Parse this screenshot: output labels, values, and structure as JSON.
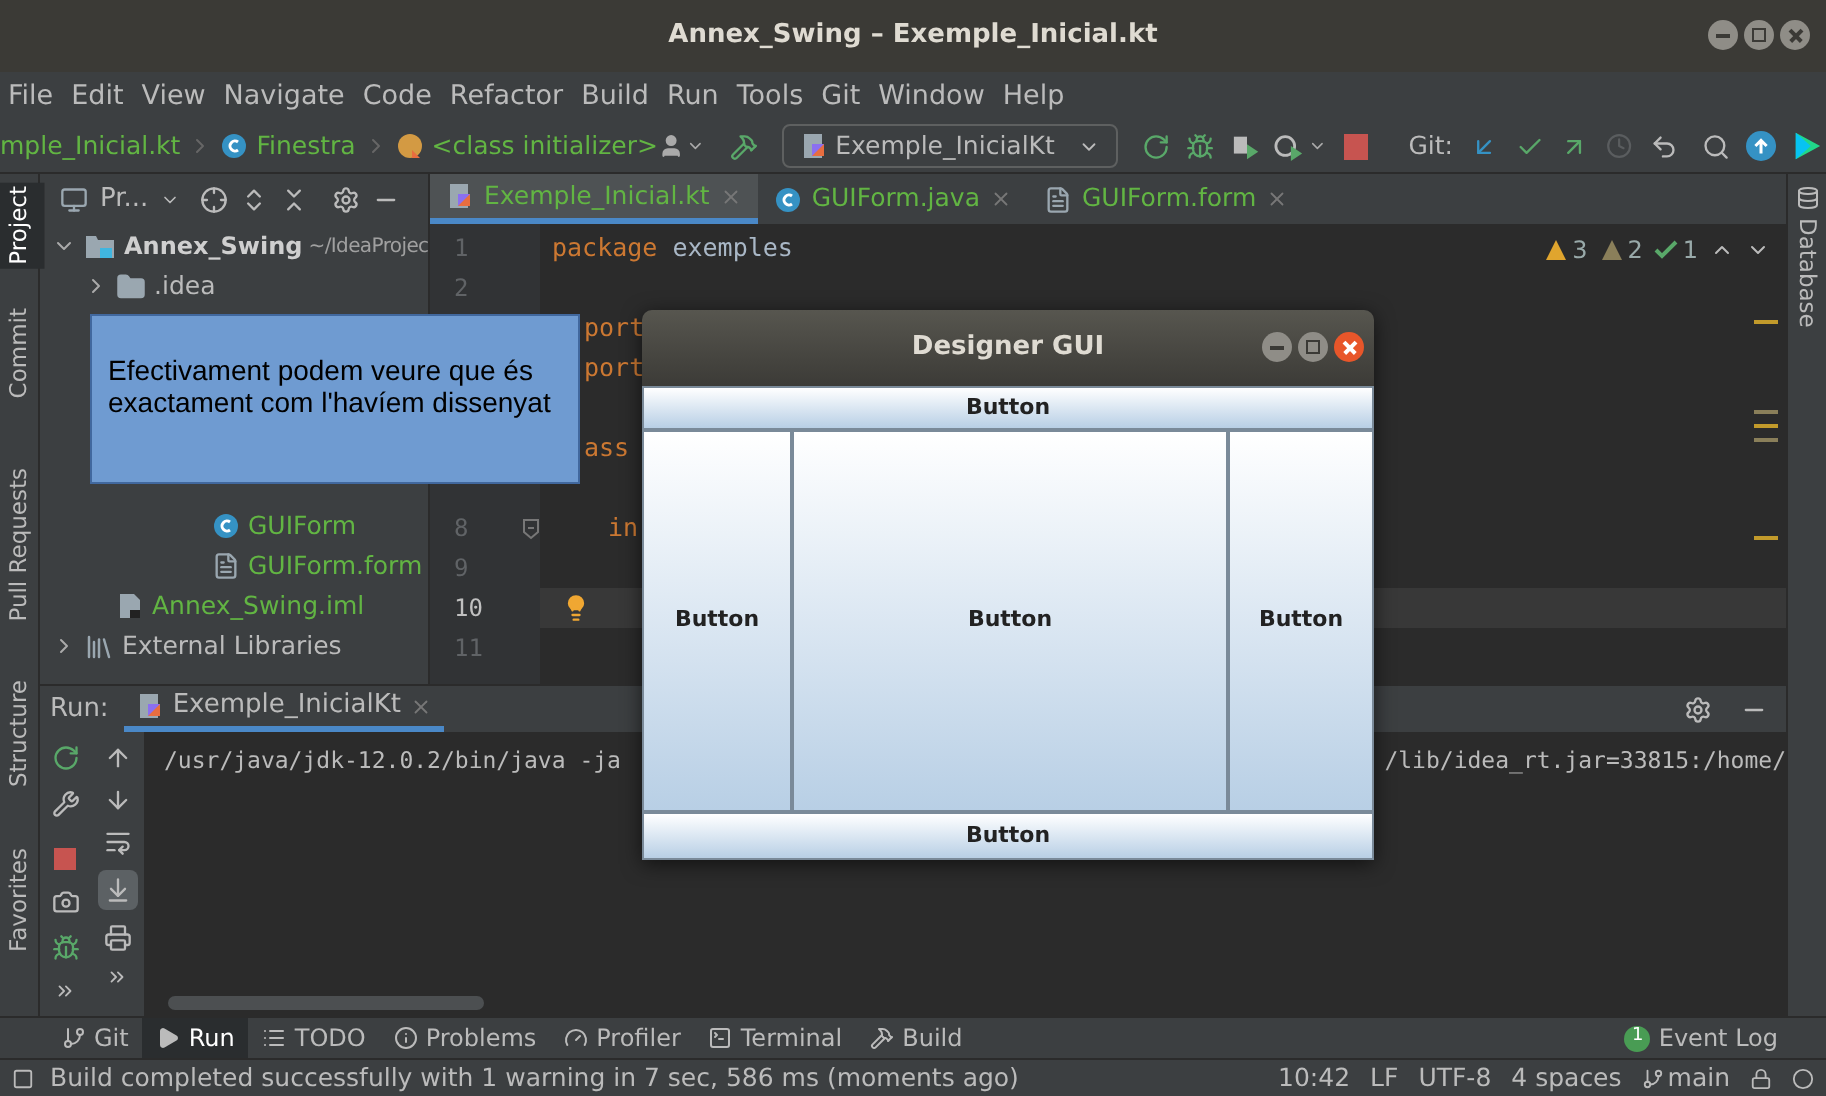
{
  "window": {
    "title": "Annex_Swing – Exemple_Inicial.kt"
  },
  "menu": [
    "File",
    "Edit",
    "View",
    "Navigate",
    "Code",
    "Refactor",
    "Build",
    "Run",
    "Tools",
    "Git",
    "Window",
    "Help"
  ],
  "breadcrumbs": [
    {
      "label": "mple_Inicial.kt",
      "kind": "file"
    },
    {
      "label": "Finestra",
      "kind": "class"
    },
    {
      "label": "<class initializer>",
      "kind": "init"
    }
  ],
  "run_config": "Exemple_InicialKt",
  "git_label": "Git:",
  "left_stripe": [
    {
      "label": "Project",
      "selected": true
    },
    {
      "label": "Commit",
      "selected": false
    },
    {
      "label": "Pull Requests",
      "selected": false
    },
    {
      "label": "Structure",
      "selected": false
    },
    {
      "label": "Favorites",
      "selected": false
    }
  ],
  "right_stripe": [
    {
      "label": "Database",
      "selected": false
    }
  ],
  "project_panel": {
    "title": "Pr...",
    "tree": [
      {
        "label": "Annex_Swing",
        "path": "~/IdeaProjec",
        "kind": "module",
        "expanded": true,
        "children": [
          {
            "label": ".idea",
            "kind": "folder",
            "expanded": false
          },
          {
            "label": "GUIForm",
            "kind": "class"
          },
          {
            "label": "GUIForm.form",
            "kind": "form"
          },
          {
            "label": "Annex_Swing.iml",
            "kind": "iml"
          }
        ]
      },
      {
        "label": "External Libraries",
        "kind": "libs",
        "expanded": false
      }
    ]
  },
  "editor": {
    "tabs": [
      {
        "label": "Exemple_Inicial.kt",
        "kind": "kotlin",
        "selected": true
      },
      {
        "label": "GUIForm.java",
        "kind": "java",
        "selected": false
      },
      {
        "label": "GUIForm.form",
        "kind": "form",
        "selected": false
      }
    ],
    "inspections": [
      {
        "count": "3",
        "kind": "warning"
      },
      {
        "count": "2",
        "kind": "weak"
      },
      {
        "count": "1",
        "kind": "ok"
      }
    ],
    "lines": [
      {
        "number": "1",
        "current": false,
        "code": [
          {
            "text": "package",
            "kind": "keyword"
          },
          {
            "text": " exemples",
            "kind": "plain"
          }
        ]
      },
      {
        "number": "2",
        "current": false
      },
      {
        "current": false,
        "code": [
          {
            "text": "port",
            "kind": "keyword"
          }
        ]
      },
      {
        "current": false,
        "code": [
          {
            "text": "port",
            "kind": "keyword"
          }
        ]
      },
      {
        "current": false
      },
      {
        "current": false,
        "code": [
          {
            "text": "ass",
            "kind": "keyword"
          }
        ]
      },
      {
        "current": false
      },
      {
        "number": "8",
        "current": false,
        "fold": true,
        "code": [
          {
            "text": "in",
            "kind": "keyword",
            "indent": true
          }
        ]
      },
      {
        "number": "9",
        "current": false
      },
      {
        "number": "10",
        "current": true,
        "bulb": true
      },
      {
        "number": "11",
        "current": false
      }
    ]
  },
  "run_panel": {
    "label": "Run:",
    "tab": "Exemple_InicialKt",
    "console": [
      "/usr/java/jdk-12.0.2/bin/java -ja",
      "/lib/idea_rt.jar=33815:/home/"
    ]
  },
  "tool_tabs": [
    {
      "label": "Git",
      "kind": "git",
      "selected": false
    },
    {
      "label": "Run",
      "kind": "run",
      "selected": true
    },
    {
      "label": "TODO",
      "kind": "todo",
      "selected": false
    },
    {
      "label": "Problems",
      "kind": "problems",
      "selected": false
    },
    {
      "label": "Profiler",
      "kind": "profiler",
      "selected": false
    },
    {
      "label": "Terminal",
      "kind": "terminal",
      "selected": false
    },
    {
      "label": "Build",
      "kind": "build",
      "selected": false
    }
  ],
  "event_log": {
    "label": "Event Log",
    "badge": "1"
  },
  "status_bar": {
    "message": "Build completed successfully with 1 warning in 7 sec, 586 ms (moments ago)",
    "items": [
      "10:42",
      "LF",
      "UTF-8",
      "4 spaces"
    ],
    "branch": "main"
  },
  "note": {
    "text": "Efectivament podem veure que és exactament com l'havíem dissenyat"
  },
  "dialog": {
    "title": "Designer GUI",
    "buttons": [
      "Button",
      "Button",
      "Button",
      "Button",
      "Button"
    ]
  }
}
